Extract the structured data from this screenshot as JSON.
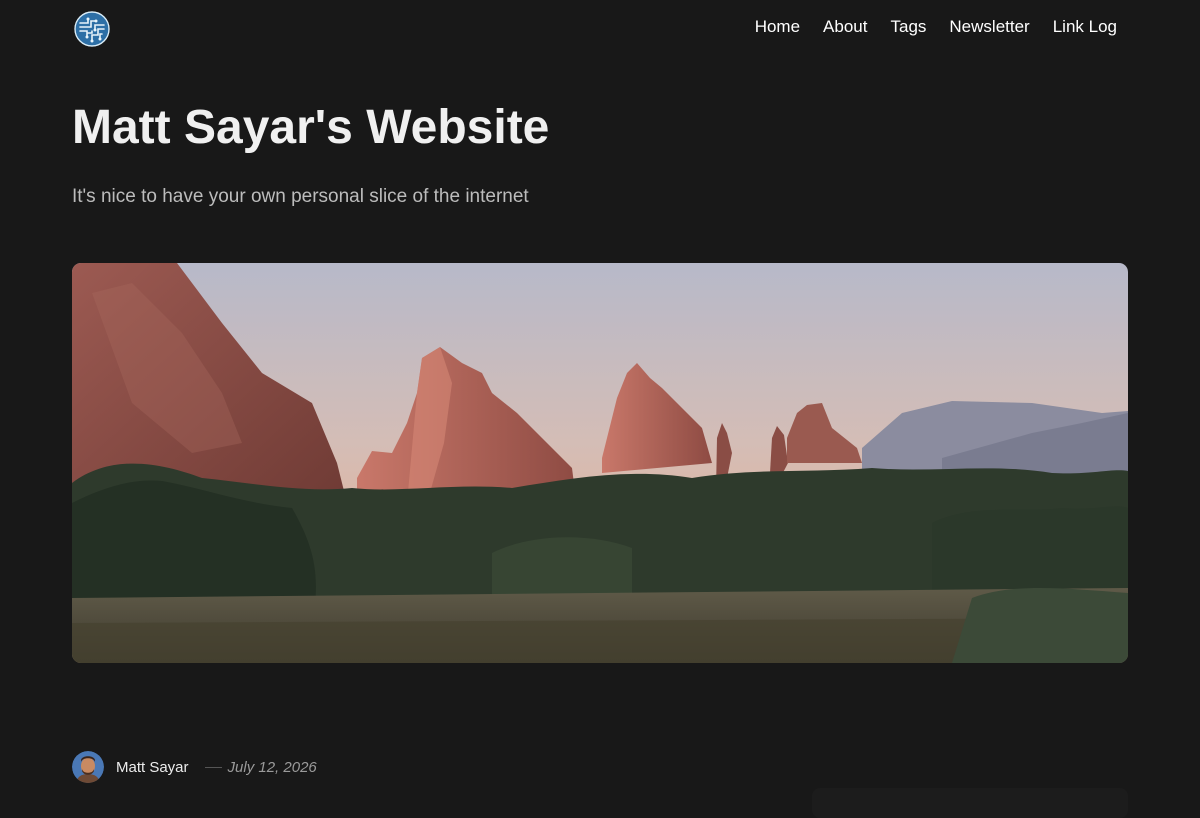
{
  "header": {
    "logo_icon": "circuit-logo-icon",
    "nav": [
      {
        "label": "Home"
      },
      {
        "label": "About"
      },
      {
        "label": "Tags"
      },
      {
        "label": "Newsletter"
      },
      {
        "label": "Link Log"
      }
    ]
  },
  "site": {
    "title": "Matt Sayar's Website",
    "tagline": "It's nice to have your own personal slice of the internet"
  },
  "hero": {
    "icon": "landscape-photo"
  },
  "post": {
    "author": "Matt Sayar",
    "date": "July 12, 2026",
    "avatar_icon": "author-avatar"
  },
  "colors": {
    "background": "#181818",
    "text": "#ffffff",
    "muted": "#bcbcbc"
  }
}
